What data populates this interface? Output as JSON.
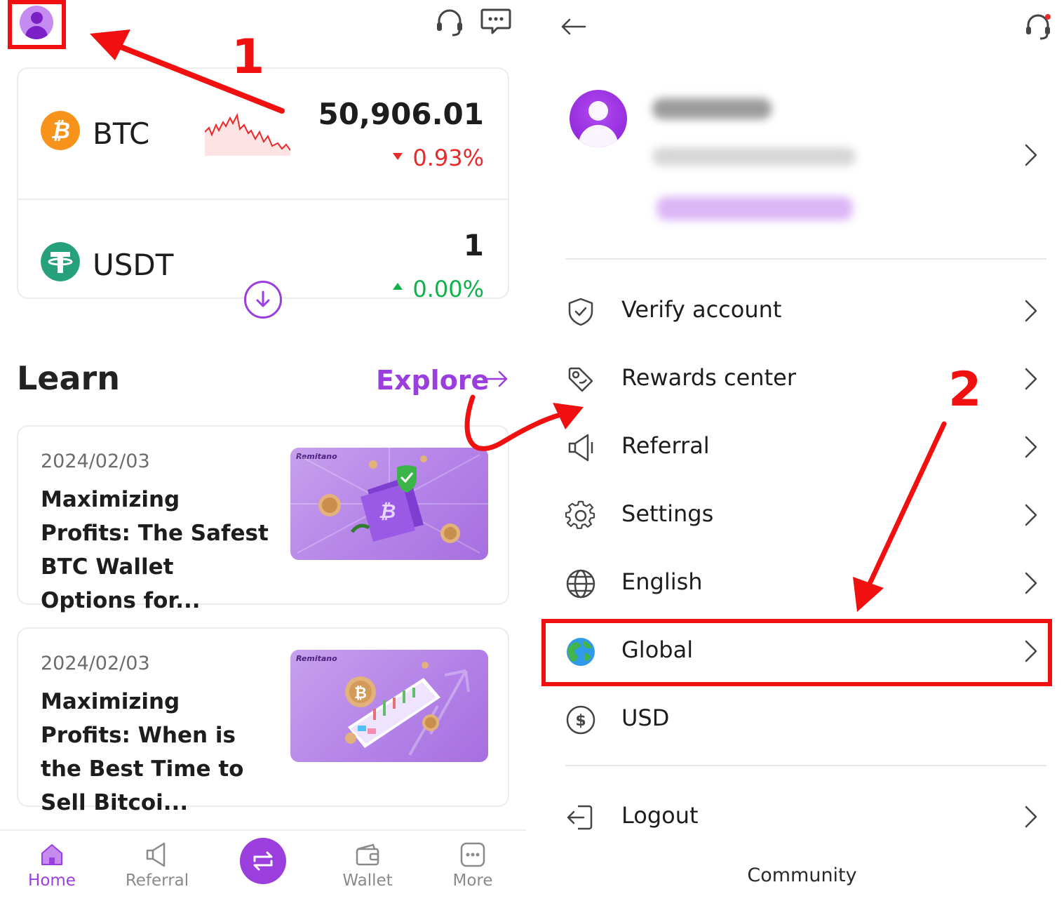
{
  "left": {
    "header": {
      "avatar_icon": "user-avatar-icon",
      "support_icon": "headset-icon",
      "chat_icon": "chat-icon"
    },
    "prices": [
      {
        "symbol": "BTC",
        "price": "50,906.01",
        "change": "0.93%",
        "direction": "down",
        "icon": "bitcoin-icon",
        "color": "#f7931a"
      },
      {
        "symbol": "USDT",
        "price": "1",
        "change": "0.00%",
        "direction": "up",
        "icon": "tether-icon",
        "color": "#26a17b"
      }
    ],
    "learn": {
      "title": "Learn",
      "explore_label": "Explore"
    },
    "articles": [
      {
        "date": "2024/02/03",
        "title": "Maximizing Profits: The Safest BTC Wallet Options for...",
        "thumb_brand": "Remitano"
      },
      {
        "date": "2024/02/03",
        "title": "Maximizing Profits: When is the Best Time to Sell Bitcoi...",
        "thumb_brand": "Remitano"
      }
    ],
    "nav": [
      {
        "label": "Home",
        "icon": "home-icon",
        "active": true
      },
      {
        "label": "Referral",
        "icon": "megaphone-icon",
        "active": false
      },
      {
        "label": "",
        "icon": "swap-icon",
        "active": false
      },
      {
        "label": "Wallet",
        "icon": "wallet-icon",
        "active": false
      },
      {
        "label": "More",
        "icon": "more-icon",
        "active": false
      }
    ]
  },
  "right": {
    "menu": [
      {
        "label": "Verify account",
        "icon": "shield-check-icon"
      },
      {
        "label": "Rewards center",
        "icon": "tag-icon"
      },
      {
        "label": "Referral",
        "icon": "megaphone-icon"
      },
      {
        "label": "Settings",
        "icon": "gear-icon"
      },
      {
        "label": "English",
        "icon": "globe-outline-icon"
      },
      {
        "label": "Global",
        "icon": "earth-icon"
      },
      {
        "label": "USD",
        "icon": "dollar-circle-icon"
      }
    ],
    "logout_label": "Logout",
    "community_label": "Community"
  },
  "annotations": {
    "step1": "1",
    "step2": "2",
    "color": "#f01010"
  },
  "colors": {
    "accent": "#9b3ede",
    "down": "#e92a2a",
    "up": "#0db24b"
  }
}
